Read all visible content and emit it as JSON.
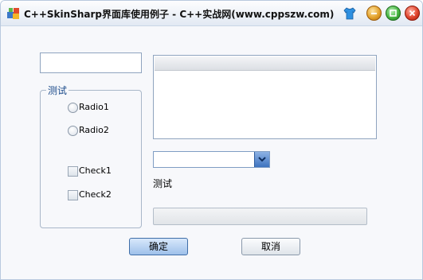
{
  "window": {
    "title": "C++SkinSharp界面库使用例子 - C++实战网(www.cppszw.com)"
  },
  "form": {
    "text_input_value": "",
    "group_label": "测试",
    "radio1_label": "Radio1",
    "radio2_label": "Radio2",
    "check1_label": "Check1",
    "check2_label": "Check2",
    "static_label": "测试",
    "combo_value": "",
    "progress_value": 0
  },
  "buttons": {
    "ok_label": "确定",
    "cancel_label": "取消"
  },
  "colors": {
    "accent": "#3f6ea8",
    "window_bg": "#f7f8fb"
  },
  "icons": {
    "app": "app-icon",
    "skin": "skin-shirt-icon",
    "minimize": "minimize-icon",
    "maximize": "maximize-icon",
    "close": "close-icon",
    "dropdown": "chevron-down-icon"
  }
}
